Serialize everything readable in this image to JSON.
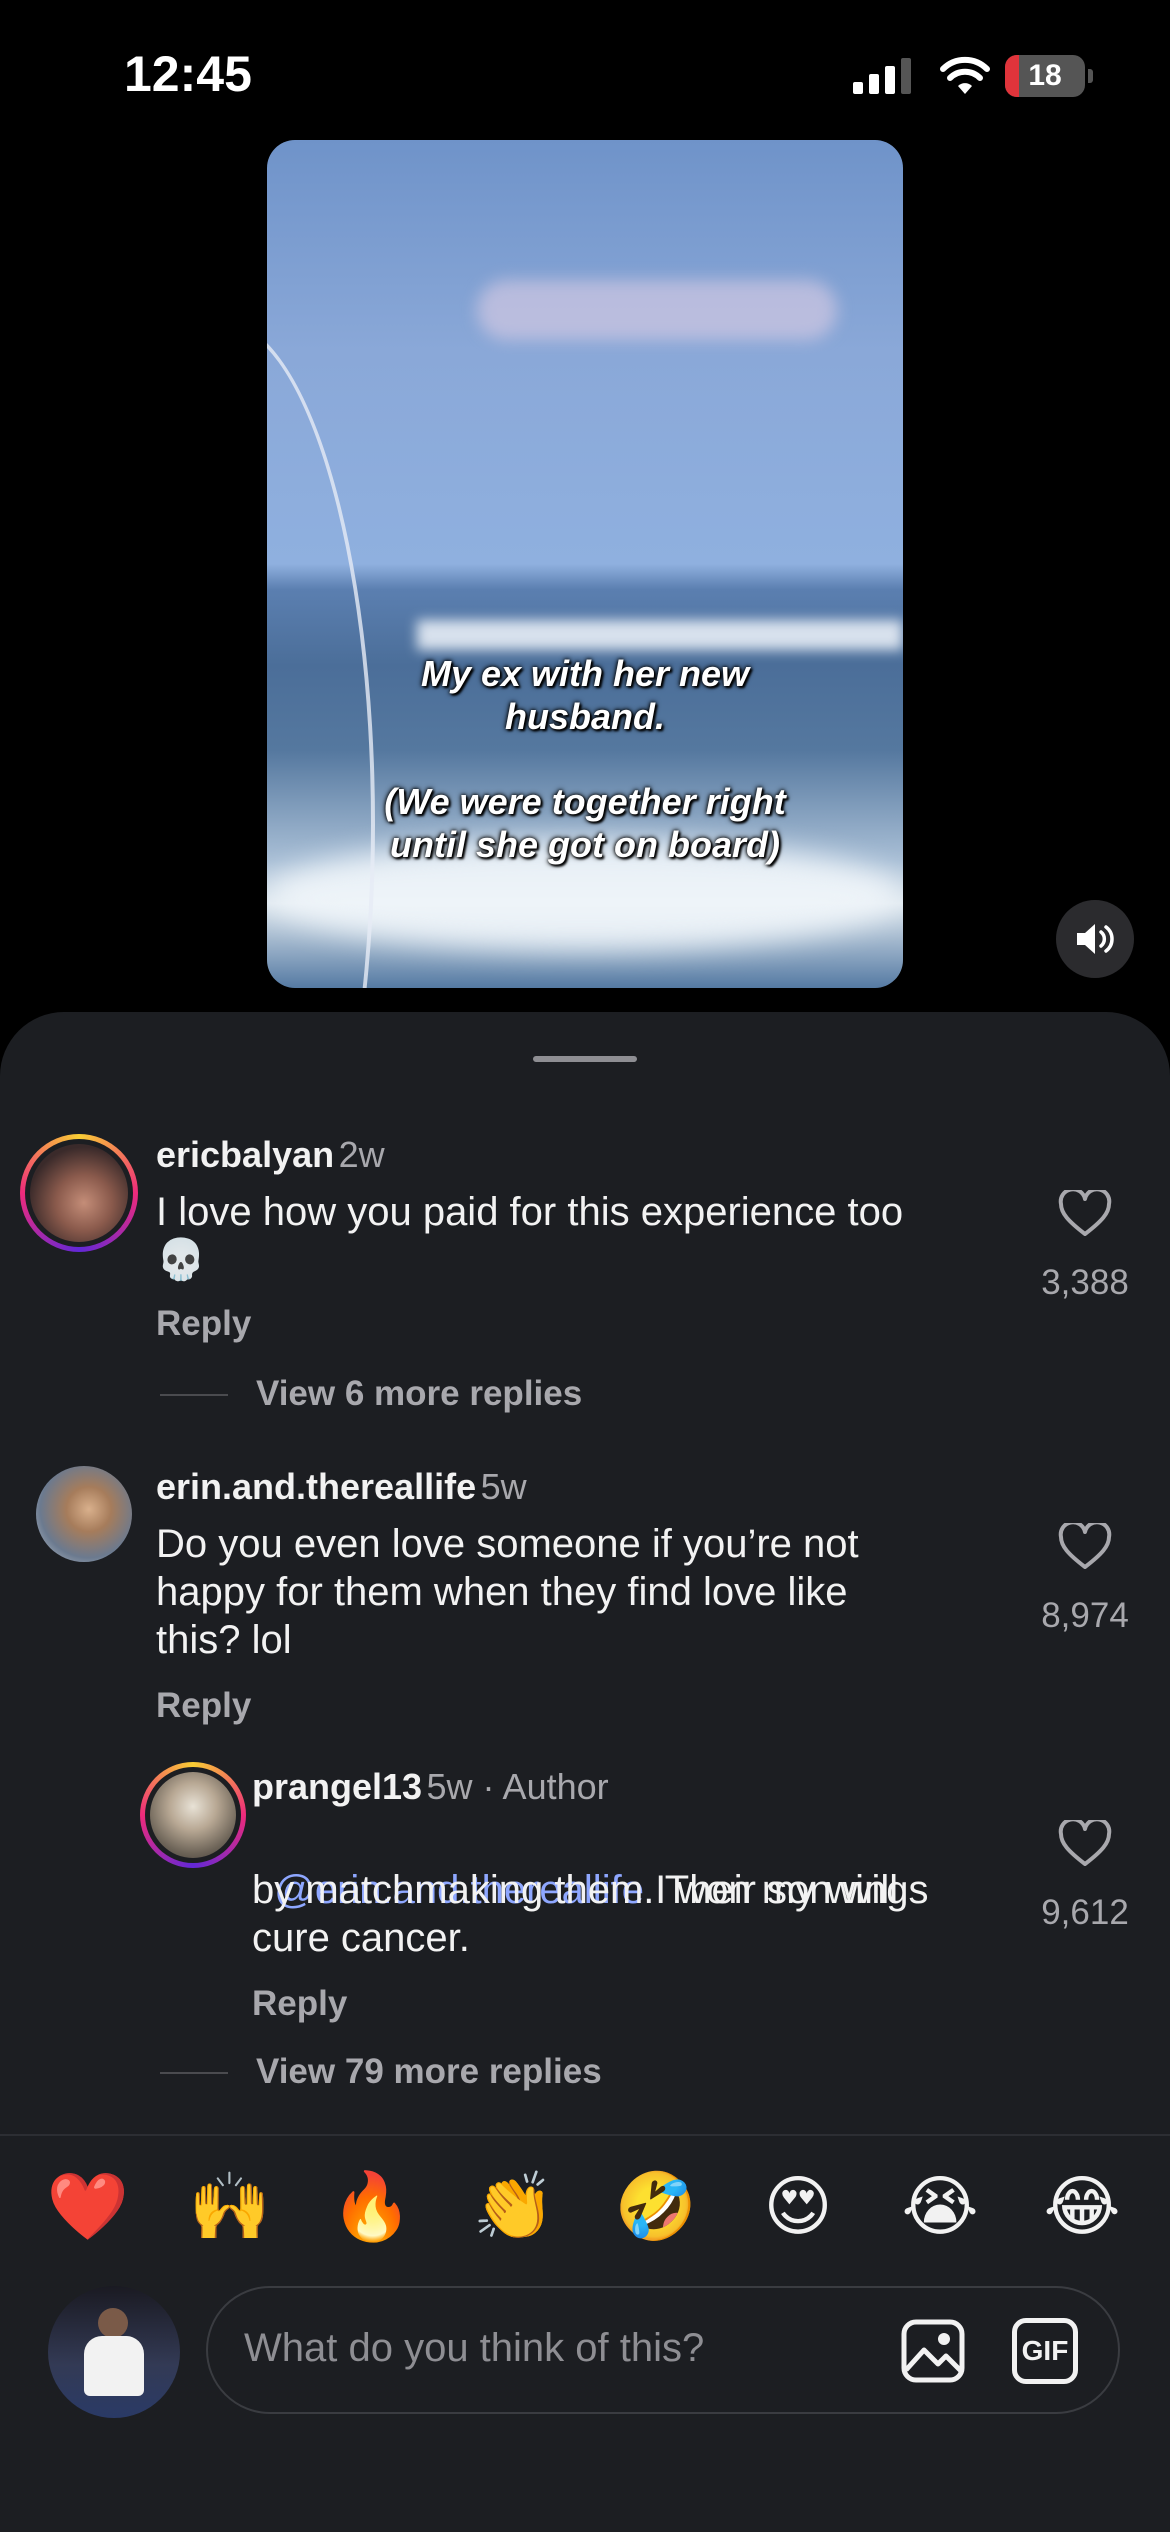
{
  "status_bar": {
    "time": "12:45",
    "battery_level": "18",
    "battery_fraction": 0.18
  },
  "video": {
    "caption_line1": "My ex with her new",
    "caption_line2": "husband.",
    "caption_line3": "(We were together right",
    "caption_line4": "until she got on board)"
  },
  "comments": [
    {
      "username": "ericbalyan",
      "age": "2w",
      "text": "I love how you paid for this experience too",
      "emoji": "💀",
      "reply_label": "Reply",
      "likes": "3,388",
      "view_more": "View 6 more replies"
    },
    {
      "username": "erin.and.thereallife",
      "age": "5w",
      "text_line1": "Do you even love someone if you’re not",
      "text_line2": "happy for them when they find love like",
      "text_line3": "this? lol",
      "reply_label": "Reply",
      "likes": "8,974",
      "replies": [
        {
          "username": "prangel13",
          "age": "5w · Author",
          "mention": "@erin.and.thereallife",
          "text_line1": " I won my wings",
          "text_line2": "by matchmaking them. Their son will",
          "text_line3": "cure cancer.",
          "reply_label": "Reply",
          "likes": "9,612"
        }
      ],
      "view_more": "View 79 more replies"
    }
  ],
  "emoji_bar": [
    "❤️",
    "🙌",
    "🔥",
    "👏",
    "🤣",
    "😍",
    "😭",
    "😂"
  ],
  "composer": {
    "placeholder": "What do you think of this?",
    "gif_label": "GIF"
  },
  "colors": {
    "mention": "#8ea7ff",
    "background": "#1c1e22",
    "battery_low": "#e0343b"
  }
}
